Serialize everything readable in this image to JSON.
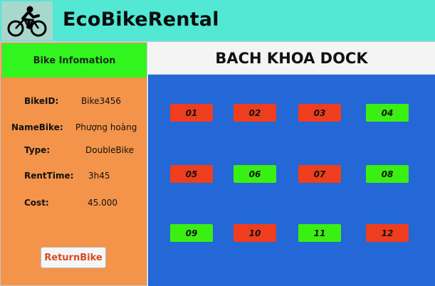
{
  "app": {
    "title": "EcoBikeRental",
    "logo_icon": "cyclist-icon"
  },
  "info": {
    "header": "Bike Infomation",
    "fields": [
      {
        "label": "BikeID:",
        "value": "Bike3456"
      },
      {
        "label": "NameBike:",
        "value": "Phượng hoàng"
      },
      {
        "label": "Type:",
        "value": "DoubleBike"
      },
      {
        "label": "RentTime:",
        "value": "3h45"
      },
      {
        "label": "Cost:",
        "value": "45.000"
      }
    ],
    "return_button": "ReturnBike"
  },
  "dock": {
    "title": "BACH KHOA DOCK",
    "slots": [
      {
        "label": "01",
        "status": "occupied"
      },
      {
        "label": "02",
        "status": "occupied"
      },
      {
        "label": "03",
        "status": "occupied"
      },
      {
        "label": "04",
        "status": "available"
      },
      {
        "label": "05",
        "status": "occupied"
      },
      {
        "label": "06",
        "status": "available"
      },
      {
        "label": "07",
        "status": "occupied"
      },
      {
        "label": "08",
        "status": "available"
      },
      {
        "label": "09",
        "status": "available"
      },
      {
        "label": "10",
        "status": "occupied"
      },
      {
        "label": "11",
        "status": "available"
      },
      {
        "label": "12",
        "status": "occupied"
      }
    ]
  },
  "colors": {
    "header_bg": "#52e8d4",
    "info_panel_bg": "#f3944a",
    "info_header_bg": "#32f51f",
    "dock_bg": "#2467d6",
    "slot_occupied": "#ee3e1e",
    "slot_available": "#3af012",
    "return_button_text": "#d64a26"
  }
}
